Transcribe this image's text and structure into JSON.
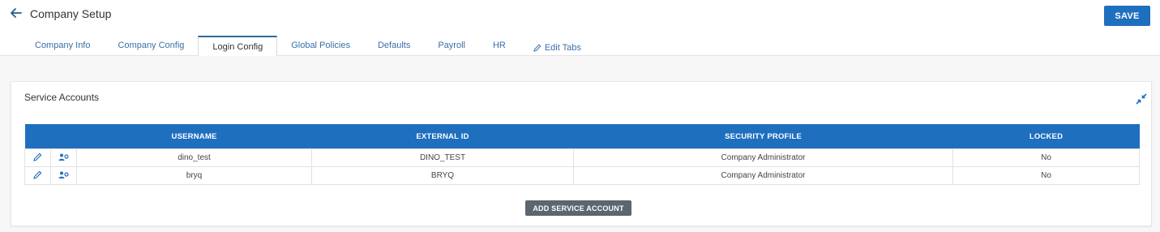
{
  "header": {
    "title": "Company Setup",
    "save_label": "SAVE"
  },
  "tabs": [
    {
      "label": "Company Info",
      "active": false
    },
    {
      "label": "Company Config",
      "active": false
    },
    {
      "label": "Login Config",
      "active": true
    },
    {
      "label": "Global Policies",
      "active": false
    },
    {
      "label": "Defaults",
      "active": false
    },
    {
      "label": "Payroll",
      "active": false
    },
    {
      "label": "HR",
      "active": false
    }
  ],
  "edit_tabs_label": "Edit Tabs",
  "service_accounts": {
    "title": "Service Accounts",
    "columns": [
      "USERNAME",
      "EXTERNAL ID",
      "SECURITY PROFILE",
      "LOCKED"
    ],
    "rows": [
      {
        "username": "dino_test",
        "external_id": "DINO_TEST",
        "security_profile": "Company Administrator",
        "locked": "No"
      },
      {
        "username": "bryq",
        "external_id": "BRYQ",
        "security_profile": "Company Administrator",
        "locked": "No"
      }
    ],
    "add_label": "ADD SERVICE ACCOUNT"
  },
  "colors": {
    "accent": "#1f6fbf",
    "tab_link": "#3a6fa8",
    "secondary_button": "#5a6670"
  },
  "icons": [
    "back-arrow-icon",
    "pencil-icon",
    "user-settings-icon",
    "collapse-arrows-icon"
  ]
}
